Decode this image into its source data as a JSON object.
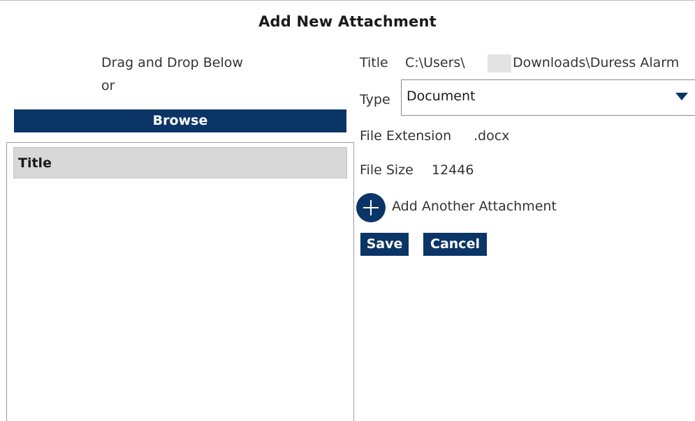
{
  "dialog": {
    "title": "Add New Attachment"
  },
  "upload": {
    "drag_text": "Drag and Drop Below",
    "or_text": "or",
    "browse_label": "Browse"
  },
  "list": {
    "header_label": "Title"
  },
  "details": {
    "title_label": "Title",
    "title_value_prefix": "C:\\Users\\",
    "title_value_suffix": "Downloads\\Duress Alarm",
    "type_label": "Type",
    "type_value": "Document",
    "extension_label": "File Extension",
    "extension_value": ".docx",
    "size_label": "File Size",
    "size_value": "12446"
  },
  "actions": {
    "add_another_label": "Add Another Attachment",
    "save_label": "Save",
    "cancel_label": "Cancel"
  },
  "colors": {
    "accent": "#0b3566",
    "header_bg": "#d8d8d8"
  },
  "icons": {
    "add": "plus-circle-icon",
    "dropdown": "caret-down-icon"
  }
}
